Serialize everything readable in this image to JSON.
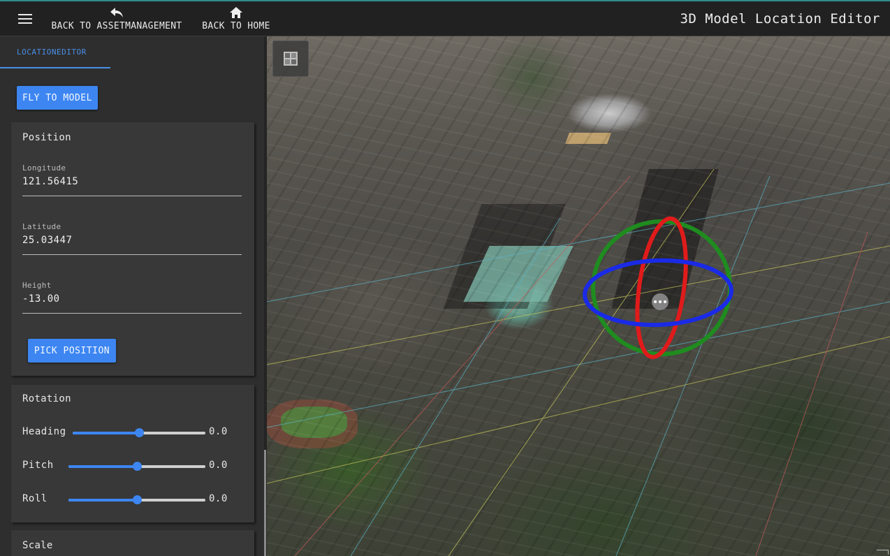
{
  "header": {
    "menu_icon": "hamburger-menu-icon",
    "back_asset_label": "BACK TO ASSETMANAGEMENT",
    "back_home_label": "BACK TO HOME",
    "title": "3D Model Location Editor"
  },
  "sidebar": {
    "tab_label": "LOCATIONEDITOR",
    "fly_button": "FLY TO MODEL",
    "position": {
      "title": "Position",
      "longitude_label": "Longitude",
      "longitude_value": "121.56415",
      "latitude_label": "Latitude",
      "latitude_value": "25.03447",
      "height_label": "Height",
      "height_value": "-13.00",
      "pick_button": "PICK POSITION"
    },
    "rotation": {
      "title": "Rotation",
      "heading_label": "Heading",
      "heading_value": "0.0",
      "heading_fraction": 0.5,
      "pitch_label": "Pitch",
      "pitch_value": "0.0",
      "pitch_fraction": 0.5,
      "roll_label": "Roll",
      "roll_value": "0.0",
      "roll_fraction": 0.5
    },
    "scale": {
      "title": "Scale"
    }
  },
  "colors": {
    "accent": "#3d86f2",
    "topbar": "#212121",
    "sidebar": "#2e2e2e",
    "card": "#383838",
    "gizmo_x": "#e01b1b",
    "gizmo_y": "#1f8c1f",
    "gizmo_z": "#1a2ae6"
  }
}
